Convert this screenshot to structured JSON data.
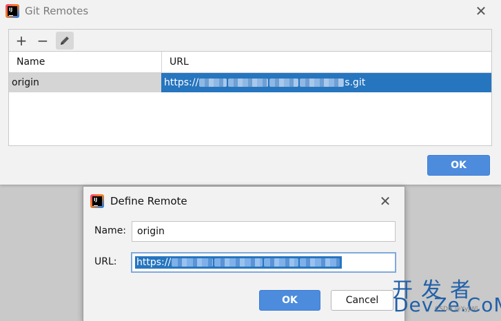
{
  "git_remotes": {
    "title": "Git Remotes",
    "toolbar": {
      "add_icon": "+",
      "remove_icon": "−",
      "edit_icon": "pencil-icon"
    },
    "table": {
      "columns": [
        "Name",
        "URL"
      ],
      "rows": [
        {
          "name": "origin",
          "url_prefix": "https://",
          "url_suffix": "s.git"
        }
      ]
    },
    "ok_label": "OK",
    "close_icon": "✕"
  },
  "define_remote": {
    "title": "Define Remote",
    "name_label": "Name:",
    "name_value": "origin",
    "url_label": "URL:",
    "url_prefix": "https://",
    "ok_label": "OK",
    "cancel_label": "Cancel",
    "close_icon": "✕"
  },
  "app_icon_text": "IJ",
  "watermark": {
    "top": "开发者",
    "bottom": "DevZe.CoM",
    "small": "CSDN @YyJWl"
  },
  "colors": {
    "selection": "#2675bf",
    "primary_button": "#4d8cdd",
    "watermark": "#2060a8"
  }
}
